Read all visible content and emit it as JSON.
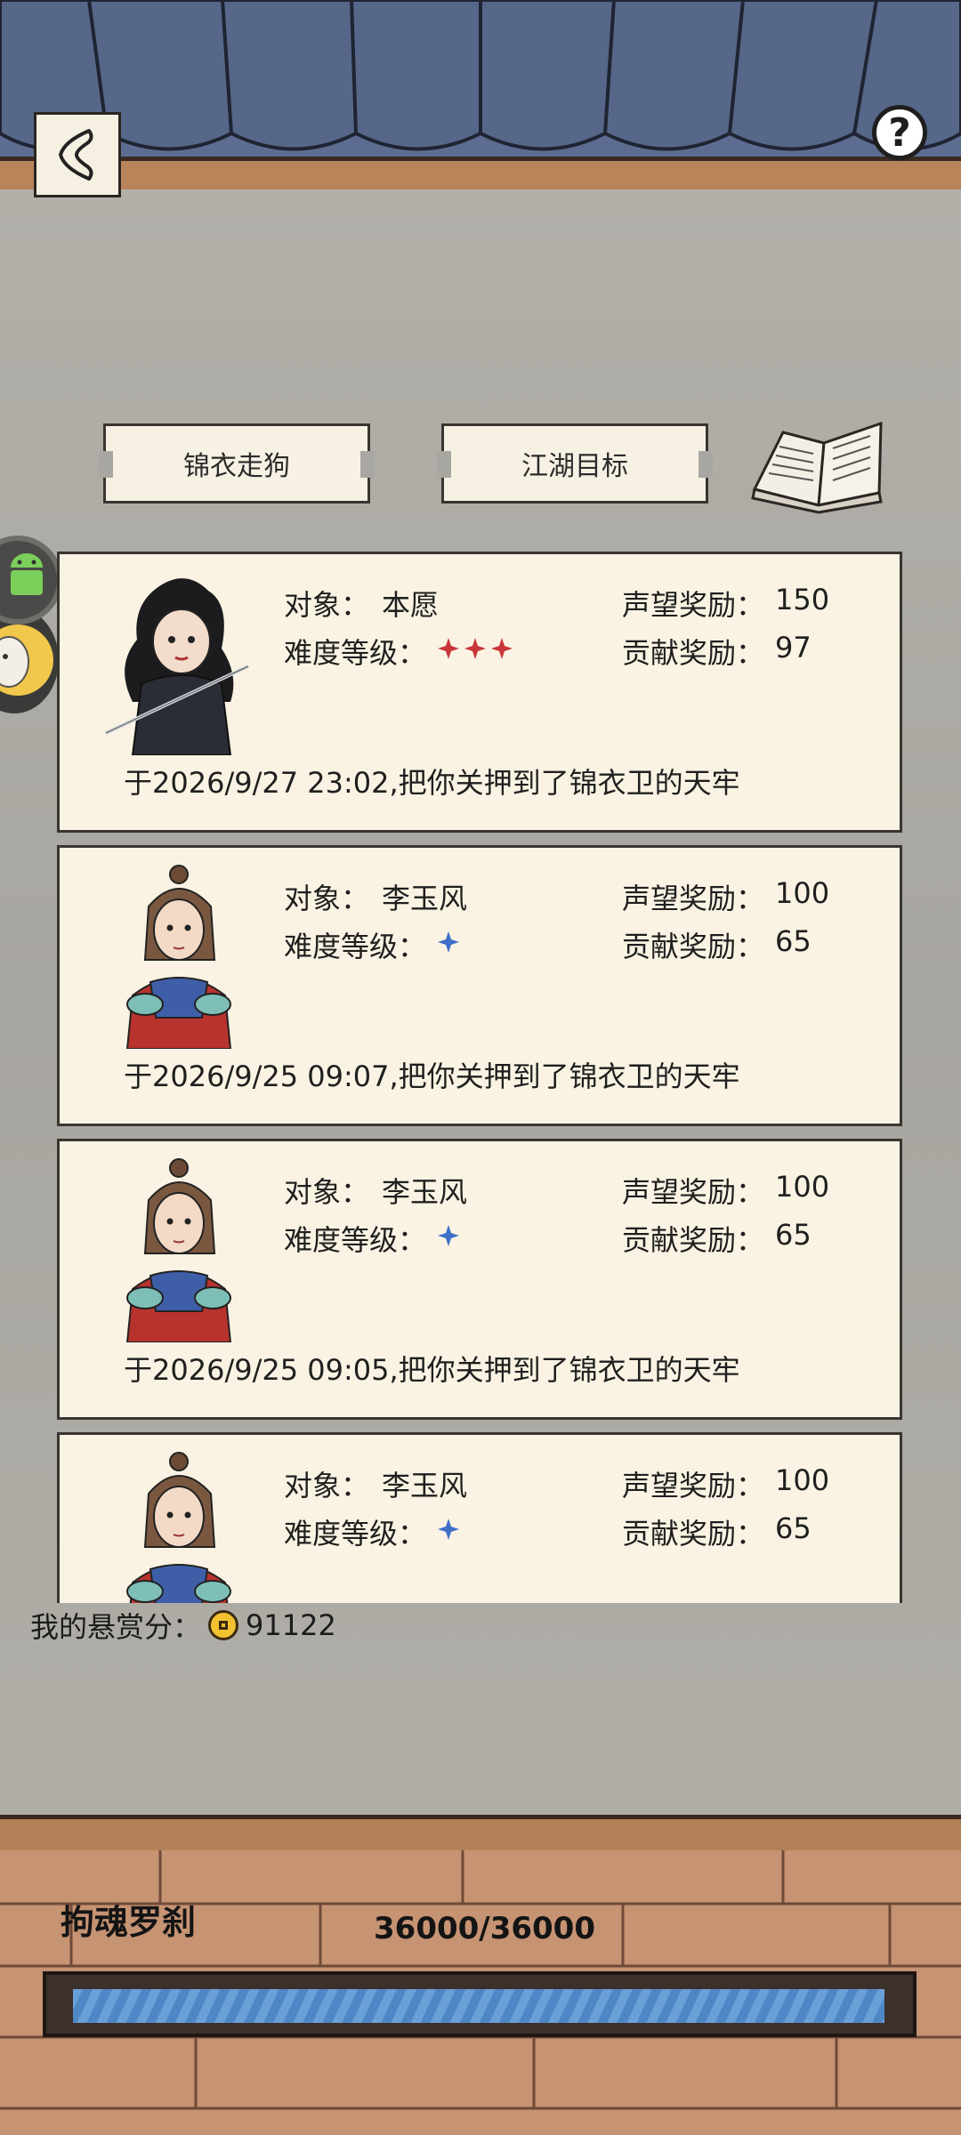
{
  "header": {
    "back_icon": "back-arrow-icon",
    "help_label": "?"
  },
  "tabs": [
    {
      "label": "锦衣走狗"
    },
    {
      "label": "江湖目标"
    }
  ],
  "book_icon": "book-icon",
  "labels": {
    "target": "对象：",
    "difficulty": "难度等级：",
    "fame_reward": "声望奖励：",
    "contribution_reward": "贡献奖励："
  },
  "cards": [
    {
      "target": "本愿",
      "difficulty_stars": 3,
      "star_color": "#c9363a",
      "fame": "150",
      "contribution": "97",
      "log": "于2026/9/27 23:02,把你关押到了锦衣卫的天牢",
      "avatar": "swordsman-black-robe"
    },
    {
      "target": "李玉风",
      "difficulty_stars": 1,
      "star_color": "#3f6fc8",
      "fame": "100",
      "contribution": "65",
      "log": "于2026/9/25 09:07,把你关押到了锦衣卫的天牢",
      "avatar": "fighter-red-blue-armor"
    },
    {
      "target": "李玉风",
      "difficulty_stars": 1,
      "star_color": "#3f6fc8",
      "fame": "100",
      "contribution": "65",
      "log": "于2026/9/25 09:05,把你关押到了锦衣卫的天牢",
      "avatar": "fighter-red-blue-armor"
    },
    {
      "target": "李玉风",
      "difficulty_stars": 1,
      "star_color": "#3f6fc8",
      "fame": "100",
      "contribution": "65",
      "log": "",
      "avatar": "fighter-red-blue-armor"
    }
  ],
  "bounty": {
    "label": "我的悬赏分：",
    "value": "91122",
    "icon": "coin-icon"
  },
  "boss": {
    "name": "拘魂罗刹",
    "hp_text": "36000/36000",
    "hp_fraction": 1.0
  }
}
